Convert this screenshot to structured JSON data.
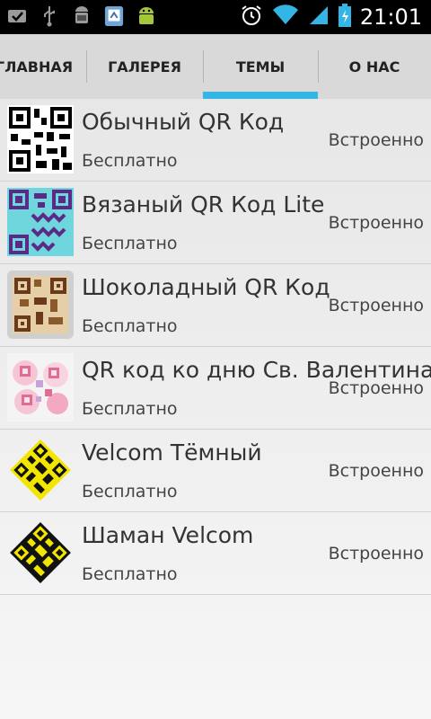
{
  "status_bar": {
    "time": "21:01",
    "icons_left": [
      "mail-check-icon",
      "usb-icon",
      "android-debug-icon",
      "sd-card-icon",
      "android-icon"
    ],
    "icons_right": [
      "alarm-icon",
      "wifi-icon",
      "signal-icon",
      "battery-icon"
    ]
  },
  "tabs": {
    "items": [
      {
        "label": "ГЛАВНАЯ"
      },
      {
        "label": "ГАЛЕРЕЯ"
      },
      {
        "label": "ТЕМЫ"
      },
      {
        "label": "О НАС"
      }
    ],
    "active_index": 2,
    "accent_color": "#33b5e5"
  },
  "themes": [
    {
      "title": "Обычный QR Код",
      "price": "Бесплатно",
      "status": "Встроенно",
      "thumb": "qr-plain"
    },
    {
      "title": "Вязаный QR Код Lite",
      "price": "Бесплатно",
      "status": "Встроенно",
      "thumb": "qr-knitted"
    },
    {
      "title": "Шоколадный QR Код",
      "price": "Бесплатно",
      "status": "Встроенно",
      "thumb": "qr-chocolate"
    },
    {
      "title": "QR код ко дню Св. Валентина",
      "price": "Бесплатно",
      "status": "Встроенно",
      "thumb": "qr-valentine"
    },
    {
      "title": "Velcom Тёмный",
      "price": "Бесплатно",
      "status": "Встроенно",
      "thumb": "qr-velcom-dark"
    },
    {
      "title": "Шаман Velcom",
      "price": "Бесплатно",
      "status": "Встроенно",
      "thumb": "qr-velcom-shaman"
    }
  ]
}
